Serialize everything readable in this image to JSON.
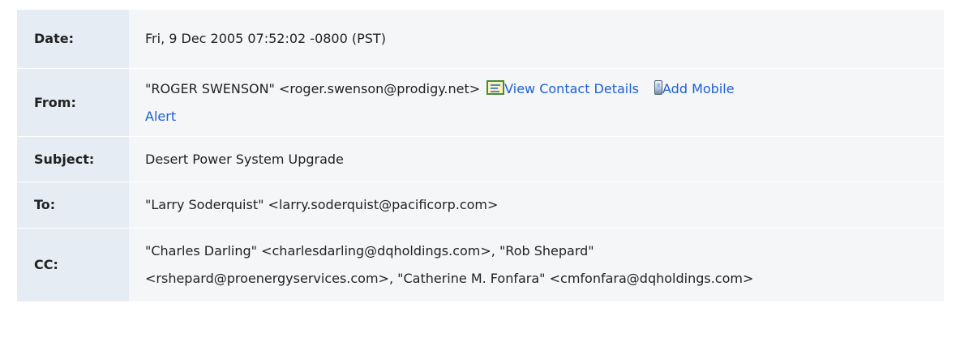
{
  "email": {
    "date_label": "Date:",
    "date_value": "Fri, 9 Dec 2005 07:52:02 -0800 (PST)",
    "from_label": "From:",
    "from_value": "\"ROGER SWENSON\" <roger.swenson@prodigy.net>",
    "view_contact_label": "View Contact Details",
    "add_mobile_label_line1": "Add Mobile",
    "add_mobile_label_line2": "Alert",
    "subject_label": "Subject:",
    "subject_value": "Desert Power System Upgrade",
    "to_label": "To:",
    "to_value": "\"Larry Soderquist\" <larry.soderquist@pacificorp.com>",
    "cc_label": "CC:",
    "cc_line1": "\"Charles Darling\" <charlesdarling@dqholdings.com>, \"Rob Shepard\"",
    "cc_line2": "<rshepard@proenergyservices.com>, \"Catherine M. Fonfara\" <cmfonfara@dqholdings.com>"
  },
  "icons": {
    "contact": "contact-card-icon",
    "mobile": "mobile-phone-icon"
  },
  "colors": {
    "label_bg": "#e5ecf3",
    "value_bg": "#f4f6f8",
    "link": "#1f5fd6"
  }
}
